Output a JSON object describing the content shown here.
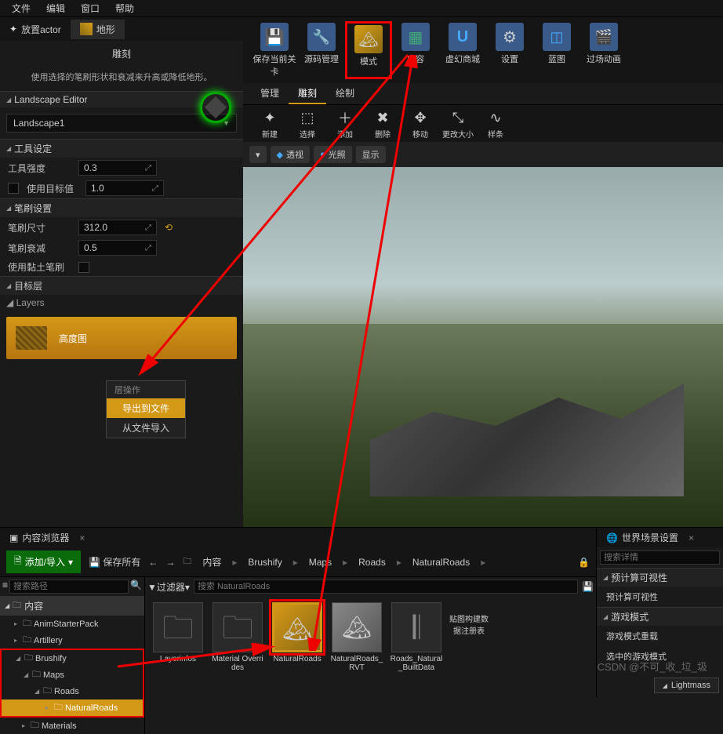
{
  "menubar": {
    "file": "文件",
    "edit": "编辑",
    "window": "窗口",
    "help": "帮助"
  },
  "left_tabs": {
    "place_actor": "放置actor",
    "landscape": "地形"
  },
  "sculpt": {
    "title": "雕刻",
    "desc": "使用选择的笔刷形状和衰减来升高或降低地形。"
  },
  "landscape_editor": {
    "header": "Landscape Editor",
    "dropdown": "Landscape1"
  },
  "tool_settings": {
    "header": "工具设定",
    "strength_label": "工具强度",
    "strength_val": "0.3",
    "use_target_label": "使用目标值",
    "target_val": "1.0"
  },
  "brush_settings": {
    "header": "笔刷设置",
    "size_label": "笔刷尺寸",
    "size_val": "312.0",
    "falloff_label": "笔刷衰减",
    "falloff_val": "0.5",
    "clay_label": "使用黏土笔刷"
  },
  "target_layers": {
    "header": "目标层",
    "layers_label": "Layers",
    "heightmap": "高度图"
  },
  "context_menu": {
    "header": "层操作",
    "export": "导出到文件",
    "import": "从文件导入"
  },
  "main_toolbar": {
    "save": "保存当前关卡",
    "source": "源码管理",
    "modes": "模式",
    "content": "内容",
    "market": "虚幻商城",
    "settings": "设置",
    "blueprint": "蓝图",
    "cinematic": "过场动画"
  },
  "mode_tabs": {
    "manage": "管理",
    "sculpt": "雕刻",
    "paint": "绘制"
  },
  "mode_tools": {
    "new": "新建",
    "select": "选择",
    "add": "添加",
    "delete": "删除",
    "move": "移动",
    "resize": "更改大小",
    "spline": "样条"
  },
  "viewport": {
    "perspective": "透视",
    "lit": "光照",
    "show": "显示"
  },
  "content_browser": {
    "tab": "内容浏览器",
    "add_import": "添加/导入",
    "save_all": "保存所有",
    "path_root": "内容",
    "breadcrumb": [
      "内容",
      "Brushify",
      "Maps",
      "Roads",
      "NaturalRoads"
    ],
    "search_path_placeholder": "搜索路径",
    "filters": "过滤器",
    "search_items_placeholder": "搜索 NaturalRoads",
    "tree": {
      "content": "内容",
      "anim": "AnimStarterPack",
      "artillery": "Artillery",
      "brushify": "Brushify",
      "maps": "Maps",
      "roads": "Roads",
      "natural_roads": "NaturalRoads",
      "materials": "Materials"
    },
    "items": {
      "layerinfos": "Layerinfos",
      "material_ovr": "Material Overrides",
      "natural_roads": "NaturalRoads",
      "natural_roads_rvt": "NaturalRoads_RVT",
      "roads_built": "Roads_Natural_BuiltData",
      "docs_label": "贴图构建数据注册表"
    }
  },
  "world_settings": {
    "tab": "世界场景设置",
    "search_placeholder": "搜索详情",
    "precomp_header": "预计算可视性",
    "precomp": "预计算可视性",
    "gamemode_header": "游戏模式",
    "gamemode_reset": "游戏模式重载",
    "selected_gamemode": "选中的游戏模式",
    "lightmass": "Lightmass"
  },
  "watermark": "CSDN @不可_收_垃_圾"
}
